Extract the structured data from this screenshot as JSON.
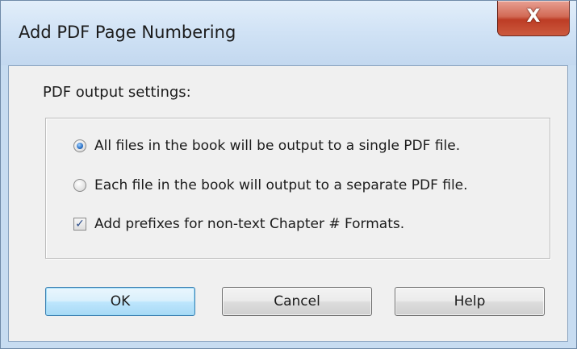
{
  "window": {
    "title": "Add PDF Page Numbering",
    "close_label": "X"
  },
  "settings": {
    "group_label": "PDF output settings:",
    "options": [
      {
        "label": "All files in the book will be output to a single PDF file.",
        "type": "radio",
        "checked": true
      },
      {
        "label": "Each file in the book will output to a separate PDF file.",
        "type": "radio",
        "checked": false
      },
      {
        "label": "Add prefixes for non-text Chapter # Formats.",
        "type": "checkbox",
        "checked": true
      }
    ]
  },
  "buttons": {
    "ok": "OK",
    "cancel": "Cancel",
    "help": "Help"
  },
  "icons": {
    "close": "close-icon",
    "checkmark": "✓"
  },
  "colors": {
    "window_frame": "#c7dcf1",
    "close_button": "#c7432c",
    "default_button": "#bee6fd",
    "radio_selected": "#2a6fc4"
  }
}
